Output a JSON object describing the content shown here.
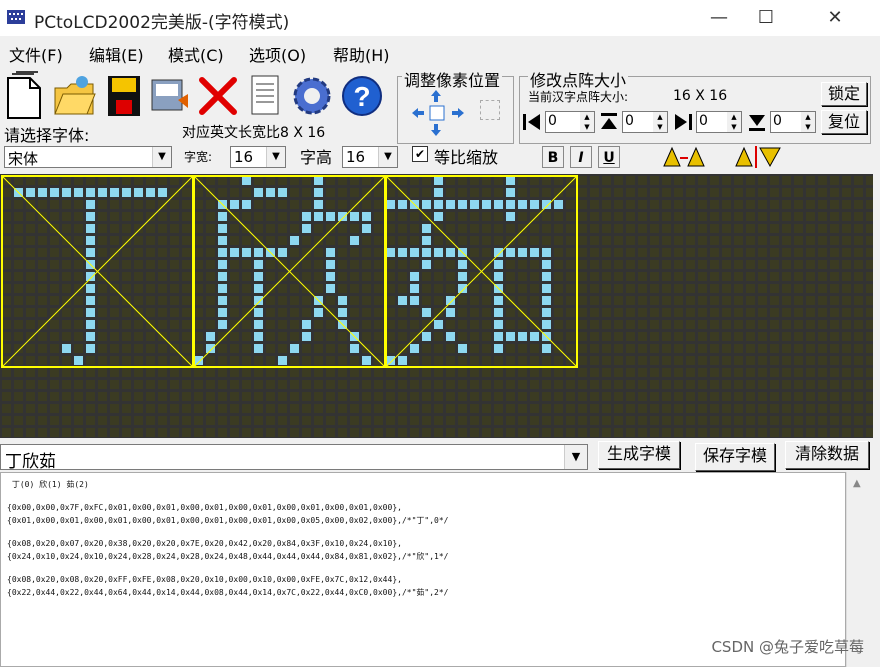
{
  "window": {
    "title": "PCtoLCD2002完美版-(字符模式)",
    "controls": [
      "—",
      "☐",
      "✕"
    ]
  },
  "menu": [
    "文件(F)",
    "编辑(E)",
    "模式(C)",
    "选项(O)",
    "帮助(H)"
  ],
  "toolbar": {
    "icons": [
      "new-file-icon",
      "open-folder-icon",
      "save-disk-icon",
      "generate-icon",
      "delete-x-icon",
      "notepad-icon",
      "settings-gear-icon",
      "help-question-icon"
    ]
  },
  "pixel_adjust": {
    "title": "调整像素位置"
  },
  "matrix": {
    "title": "修改点阵大小",
    "current_label": "当前汉字点阵大小:",
    "current_value": "16 X 16",
    "lock_label": "锁定",
    "reset_label": "复位",
    "spinners": [
      "0",
      "0",
      "0",
      "0"
    ]
  },
  "font": {
    "select_label": "请选择字体:",
    "ascii_label": "对应英文长宽比8 X 16",
    "font_value": "宋体",
    "width_label": "字宽:",
    "width_value": "16",
    "height_label": "字高",
    "height_value": "16",
    "scale_label": "等比缩放",
    "scale_checked": true
  },
  "format_buttons": [
    "B",
    "I",
    "U"
  ],
  "grid": {
    "cols": 39,
    "rows": 12,
    "colors": {
      "off": "#3b3b22",
      "on": "#8ed8f0",
      "frame": "#ffff00",
      "bg": "#333333"
    }
  },
  "input": {
    "text": "丁欣茹",
    "generate_label": "生成字模",
    "save_label": "保存字模",
    "clear_label": "清除数据"
  },
  "output_lines": [
    " 丁(0) 欣(1) 茹(2)",
    "",
    "{0x00,0x00,0x7F,0xFC,0x01,0x00,0x01,0x00,0x01,0x00,0x01,0x00,0x01,0x00,0x01,0x00},",
    "{0x01,0x00,0x01,0x00,0x01,0x00,0x01,0x00,0x01,0x00,0x01,0x00,0x05,0x00,0x02,0x00},/*\"丁\",0*/",
    "",
    "{0x08,0x20,0x07,0x20,0x38,0x20,0x20,0x7E,0x20,0x42,0x20,0x84,0x3F,0x10,0x24,0x10},",
    "{0x24,0x10,0x24,0x10,0x24,0x28,0x24,0x28,0x24,0x48,0x44,0x44,0x44,0x84,0x81,0x02},/*\"欣\",1*/",
    "",
    "{0x08,0x20,0x08,0x20,0xFF,0xFE,0x08,0x20,0x10,0x00,0x10,0x00,0xFE,0x7C,0x12,0x44},",
    "{0x22,0x44,0x22,0x44,0x64,0x44,0x14,0x44,0x08,0x44,0x14,0x7C,0x22,0x44,0xC0,0x00},/*\"茹\",2*/"
  ],
  "watermark": "CSDN @兔子爱吃草莓"
}
